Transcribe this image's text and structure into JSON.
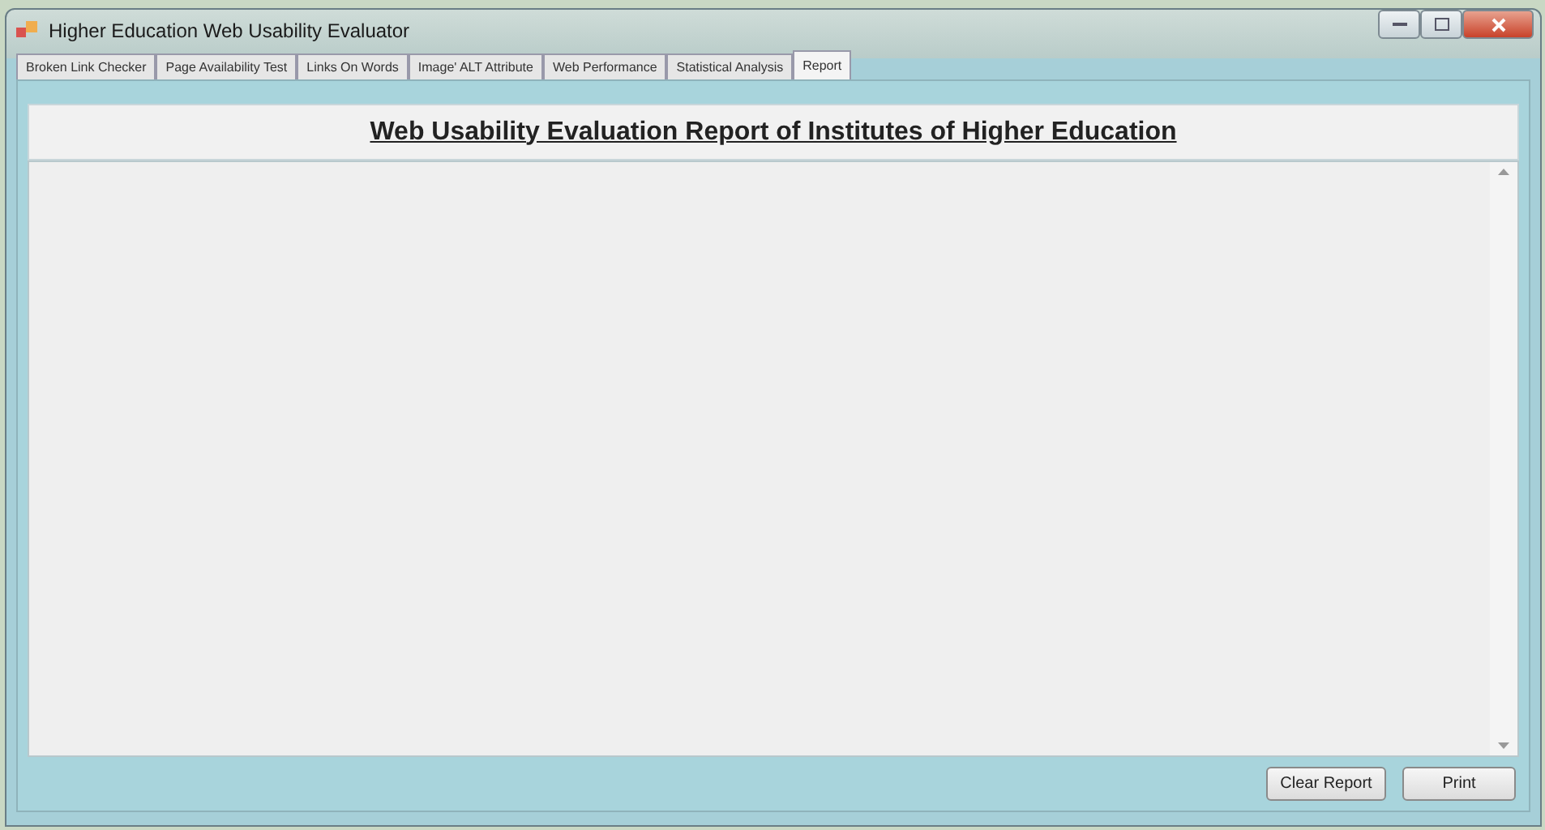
{
  "window": {
    "title": "Higher Education Web Usability Evaluator"
  },
  "tabs": [
    {
      "label": "Broken Link Checker",
      "selected": false
    },
    {
      "label": "Page Availability  Test",
      "selected": false
    },
    {
      "label": "Links On Words",
      "selected": false
    },
    {
      "label": "Image' ALT Attribute",
      "selected": false
    },
    {
      "label": "Web Performance",
      "selected": false
    },
    {
      "label": "Statistical Analysis",
      "selected": false
    },
    {
      "label": "Report",
      "selected": true
    }
  ],
  "report": {
    "heading": "Web Usability Evaluation Report of Institutes of Higher Education"
  },
  "buttons": [
    "Clear Report",
    "Print"
  ]
}
